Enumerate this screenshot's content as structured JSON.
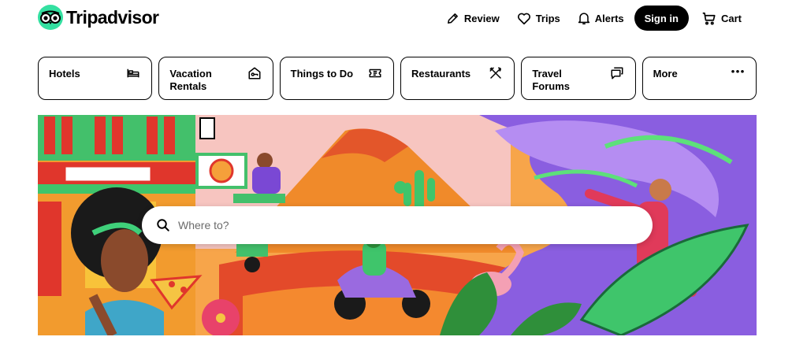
{
  "brand": {
    "name": "Tripadvisor",
    "accent": "#34e0a1"
  },
  "nav": {
    "review": "Review",
    "trips": "Trips",
    "alerts": "Alerts",
    "sign_in": "Sign in",
    "cart": "Cart"
  },
  "categories": [
    {
      "label": "Hotels",
      "icon": "bed-icon"
    },
    {
      "label": "Vacation Rentals",
      "icon": "house-key-icon"
    },
    {
      "label": "Things to Do",
      "icon": "ticket-icon"
    },
    {
      "label": "Restaurants",
      "icon": "fork-knife-icon"
    },
    {
      "label": "Travel Forums",
      "icon": "chat-bubbles-icon"
    },
    {
      "label": "More",
      "icon": "more-dots-icon"
    }
  ],
  "search": {
    "placeholder": "Where to?",
    "icon": "search-icon"
  }
}
